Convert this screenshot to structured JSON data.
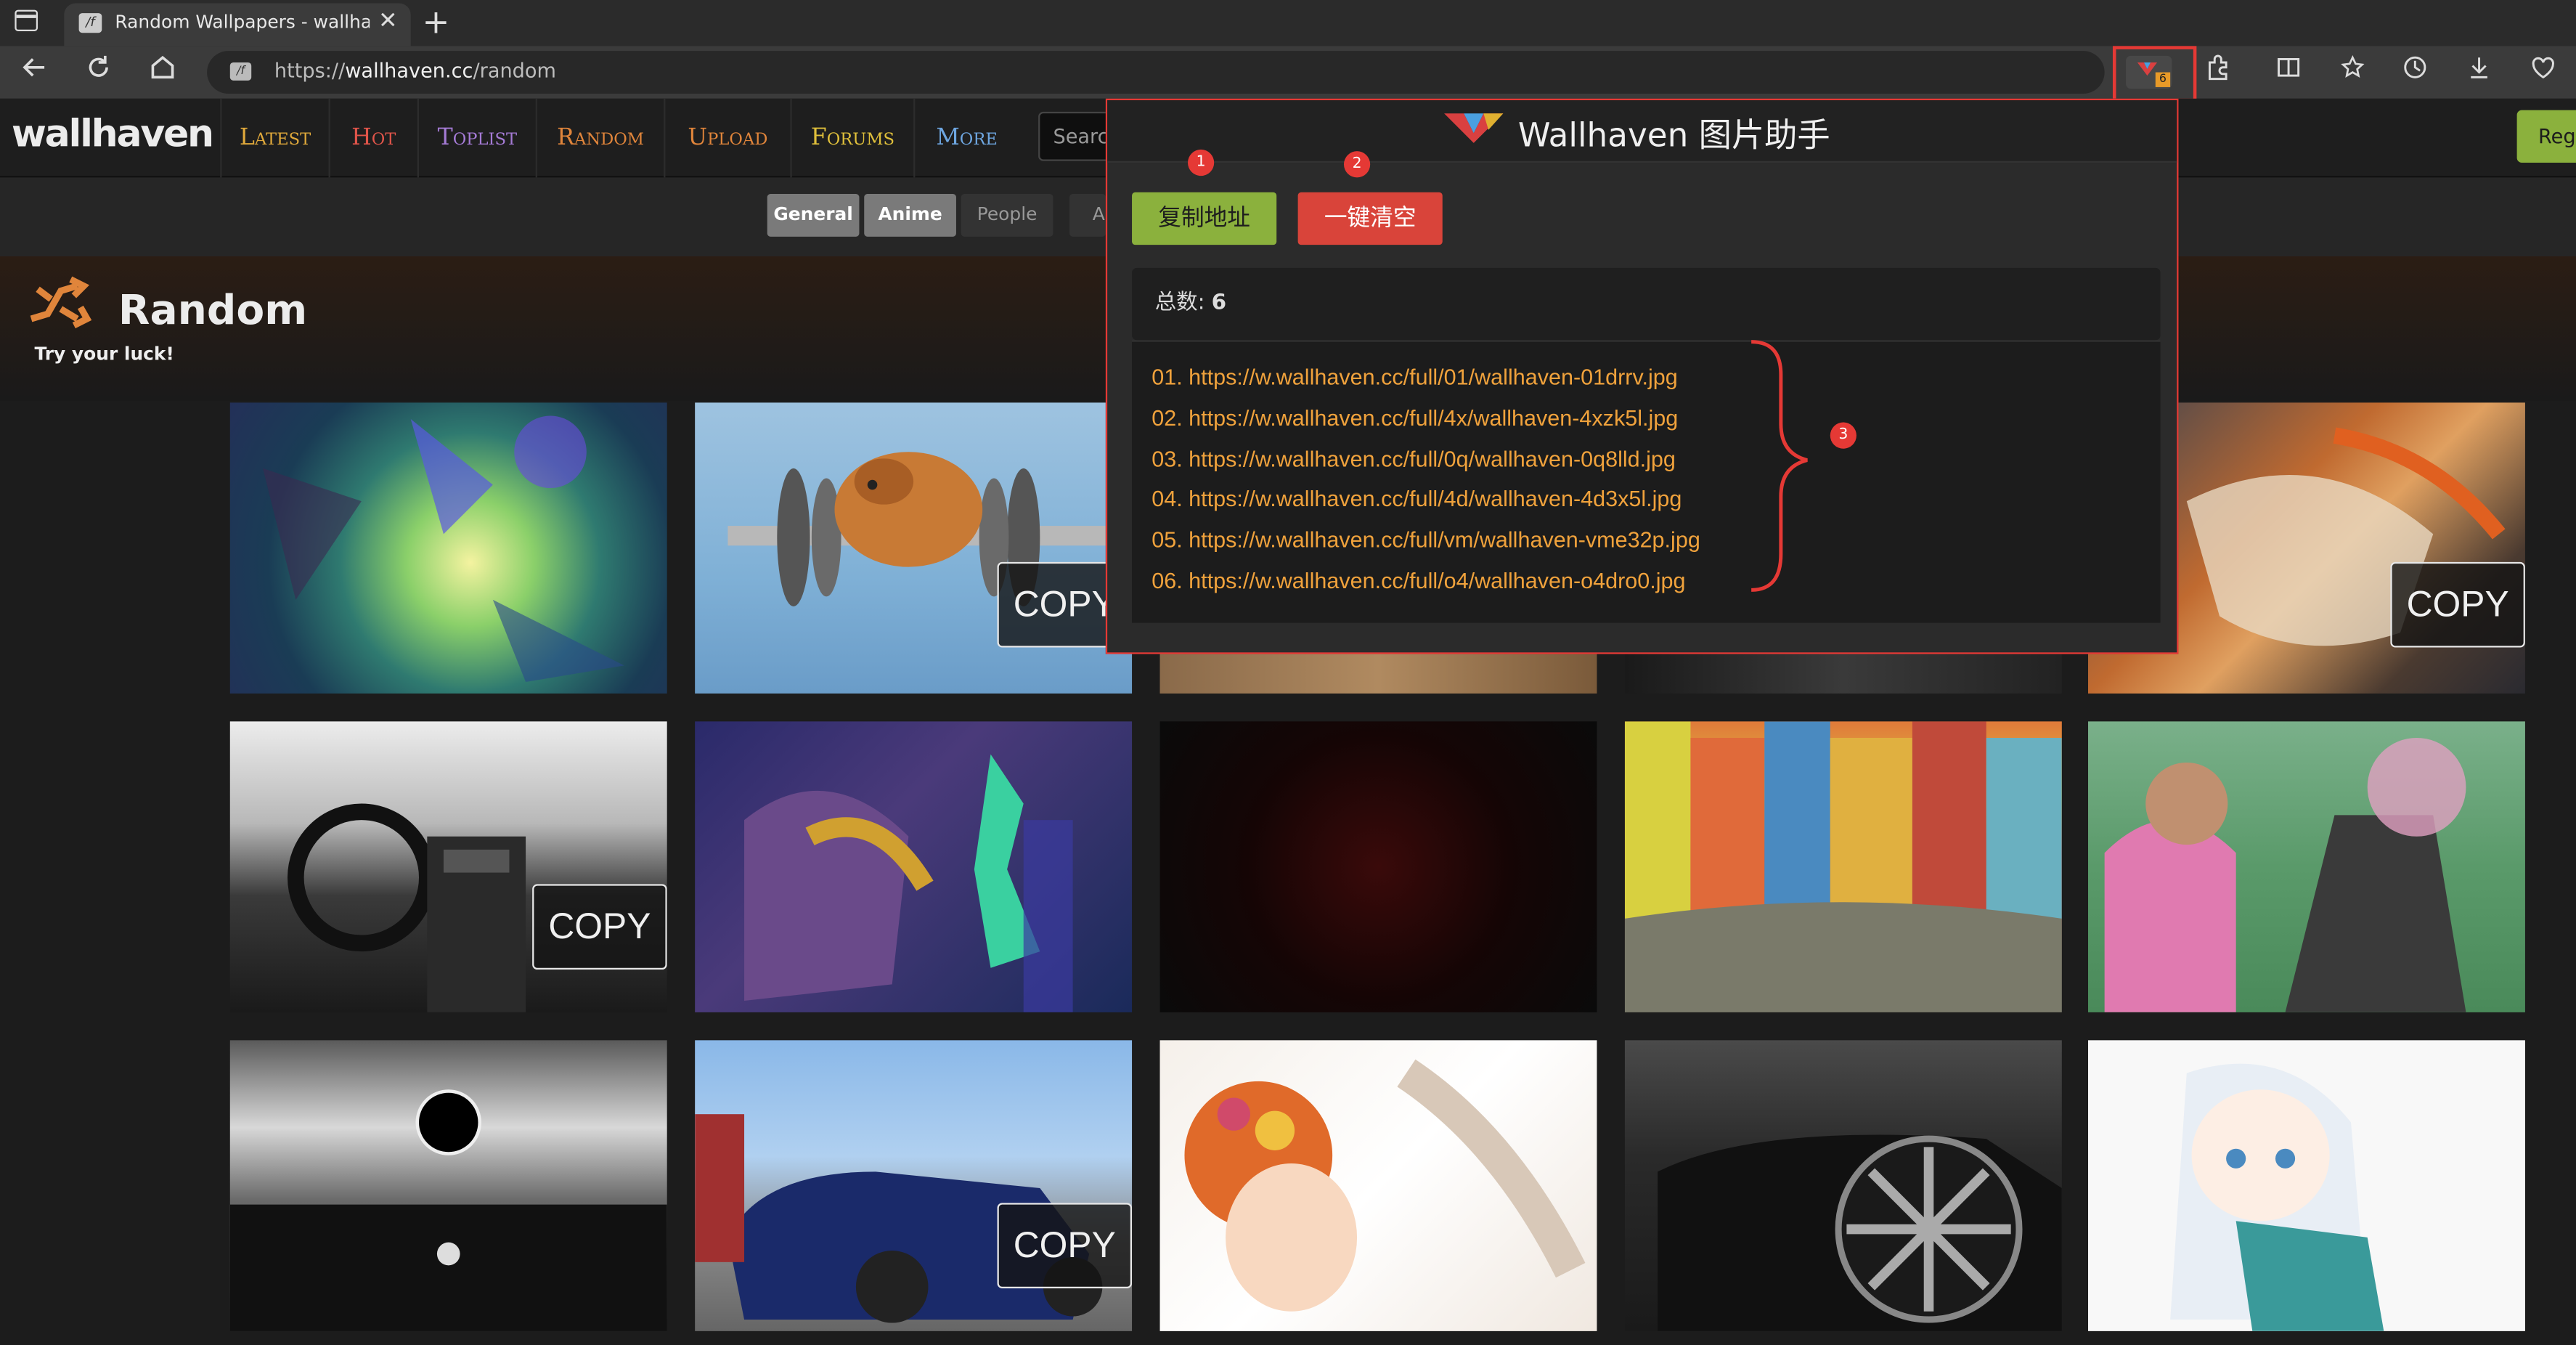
{
  "browser": {
    "tab_title": "Random Wallpapers - wallhaven.",
    "tab_close": "✕",
    "new_tab": "+",
    "url_prefix": "https://",
    "url_host": "wallhaven.cc",
    "url_path": "/random",
    "extension_badge": "6",
    "favicon_text": "/f"
  },
  "site": {
    "logo": "wallhaven",
    "menu": [
      {
        "label": "Latest",
        "color": "#e0a93b"
      },
      {
        "label": "Hot",
        "color": "#e1554a"
      },
      {
        "label": "Toplist",
        "color": "#a57bd6"
      },
      {
        "label": "Random",
        "color": "#e0853b"
      },
      {
        "label": "Upload",
        "color": "#e0853b"
      },
      {
        "label": "Forums",
        "color": "#e0c03b"
      },
      {
        "label": "More",
        "color": "#6ea6e0"
      }
    ],
    "search_placeholder": "Searc",
    "register_label": "Regi",
    "filters": [
      "General",
      "Anime",
      "People",
      "A"
    ]
  },
  "banner": {
    "title": "Random",
    "subtitle": "Try your luck!"
  },
  "thumbs": {
    "copy_label": "COPY"
  },
  "popup": {
    "title": "Wallhaven 图片助手",
    "copy_button": "复制地址",
    "clear_button": "一键清空",
    "count_label": "总数:",
    "count_value": "6",
    "markers": [
      "1",
      "2",
      "3"
    ],
    "urls": [
      "01. https://w.wallhaven.cc/full/01/wallhaven-01drrv.jpg",
      "02. https://w.wallhaven.cc/full/4x/wallhaven-4xzk5l.jpg",
      "03. https://w.wallhaven.cc/full/0q/wallhaven-0q8lld.jpg",
      "04. https://w.wallhaven.cc/full/4d/wallhaven-4d3x5l.jpg",
      "05. https://w.wallhaven.cc/full/vm/wallhaven-vme32p.jpg",
      "06. https://w.wallhaven.cc/full/o4/wallhaven-o4dro0.jpg"
    ]
  },
  "colors": {
    "accent_green": "#8bb13d",
    "accent_red": "#d9443a",
    "url_orange": "#f0a23c",
    "annotation_red": "#e53935"
  }
}
